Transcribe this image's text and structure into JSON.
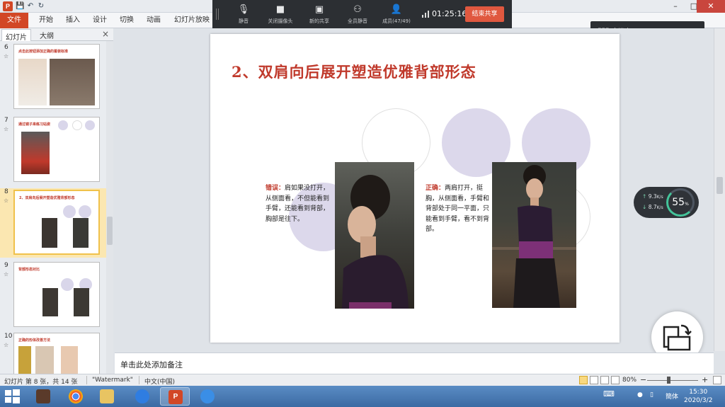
{
  "titlebar": {
    "app_logo": "P",
    "window_buttons": [
      "–",
      "□",
      "✕"
    ]
  },
  "ribbon": {
    "tabs": [
      "文件",
      "开始",
      "插入",
      "设计",
      "切换",
      "动画",
      "幻灯片放映"
    ]
  },
  "meeting_toolbar": {
    "items": [
      {
        "icon": "microphone-icon",
        "label": "静音"
      },
      {
        "icon": "camera-icon",
        "label": "关闭摄像头"
      },
      {
        "icon": "screen-share-icon",
        "label": "新的共享"
      },
      {
        "icon": "mute-all-icon",
        "label": "全员静音"
      },
      {
        "icon": "members-icon",
        "label": "成员(47/49)"
      }
    ],
    "timer": "01:25:16",
    "end_button": "结束共享"
  },
  "meeting_status": {
    "label": "会议中",
    "icon": "signal-bars-icon"
  },
  "left_panel": {
    "tabs": [
      "幻灯片",
      "大纲"
    ],
    "close": "×",
    "thumbnails": [
      {
        "num": "6",
        "title": "点击此按钮添加正确的着装标准"
      },
      {
        "num": "7",
        "title": "通过镜子来练习站姿"
      },
      {
        "num": "8",
        "title": "2、双肩向后展开塑造优雅背部形态"
      },
      {
        "num": "9",
        "title": "背部形态对比"
      },
      {
        "num": "10",
        "title": "正确的形体改善方法"
      }
    ]
  },
  "slide": {
    "title": "2、双肩向后展开塑造优雅背部形态",
    "wrong_label": "错误：",
    "wrong_text": "肩如果没打开，从侧面看，不但能看到手臂，还能看到背部，胸部是往下。",
    "right_label": "正确：",
    "right_text": "两肩打开，挺胸，从侧面看，手臂和背部处于同一平面，只能看到手臂，看不到背部。"
  },
  "network_widget": {
    "upload": "9.3",
    "download": "8.7",
    "unit": "K/s",
    "percent": "55",
    "percent_sign": "%"
  },
  "notes": {
    "placeholder": "单击此处添加备注"
  },
  "statusbar": {
    "slide_info": "幻灯片 第 8 张，共 14 张",
    "theme": "\"Watermark\"",
    "language": "中文(中国)",
    "zoom": "80%",
    "zoom_minus": "−",
    "zoom_plus": "+"
  },
  "taskbar": {
    "tray_language": "簡体",
    "time": "15:30",
    "date": "2020/3/2"
  },
  "colors": {
    "accent_red": "#c0392b",
    "file_tab": "#d24726",
    "end_share": "#e0583f",
    "circle_lavender": "#dcd8eb"
  }
}
